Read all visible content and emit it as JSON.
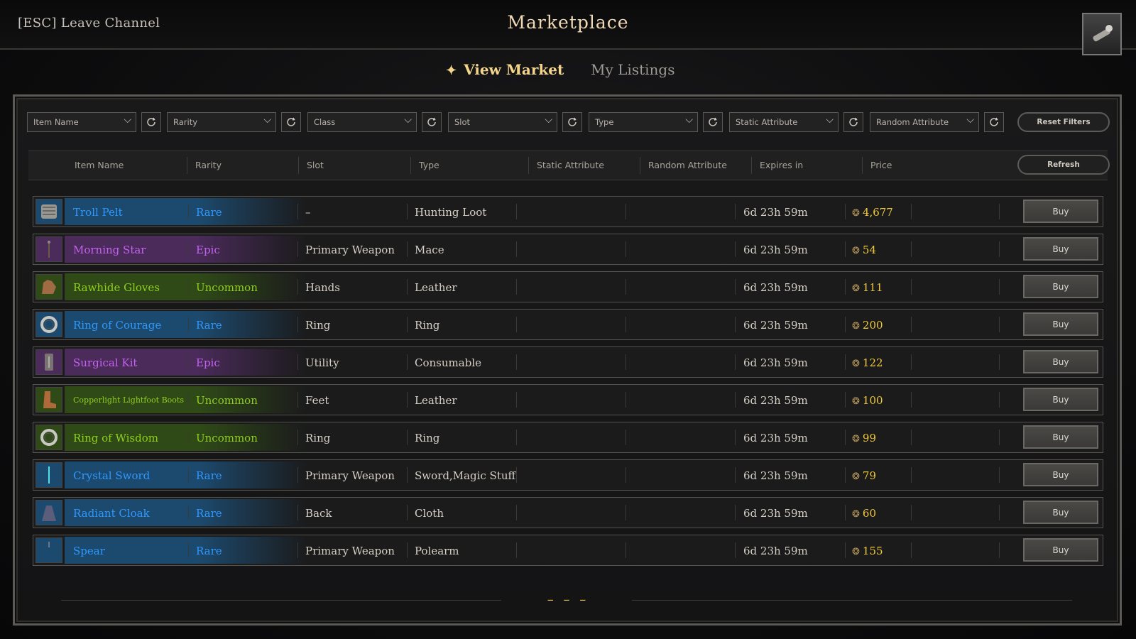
{
  "topbar": {
    "leave_label": "[ESC] Leave Channel",
    "title": "Marketplace"
  },
  "tabs": [
    {
      "label": "View Market",
      "active": true
    },
    {
      "label": "My Listings",
      "active": false
    }
  ],
  "filters": {
    "dropdowns": [
      "Item Name",
      "Rarity",
      "Class",
      "Slot",
      "Type",
      "Static Attribute",
      "Random Attribute"
    ],
    "reset_label": "Reset Filters"
  },
  "columns": [
    "Item Name",
    "Rarity",
    "Slot",
    "Type",
    "Static Attribute",
    "Random Attribute",
    "Expires in",
    "Price"
  ],
  "refresh_label": "Refresh",
  "buy_label": "Buy",
  "rarity_colors": {
    "Rare": "#2f98ff",
    "Epic": "#c463f0",
    "Uncommon": "#8fcf1e"
  },
  "items": [
    {
      "name": "Troll Pelt",
      "rarity": "Rare",
      "slot": "–",
      "type": "Hunting Loot",
      "expires": "6d 23h 59m",
      "price": "4,677",
      "icon": "pelt-icon"
    },
    {
      "name": "Morning Star",
      "rarity": "Epic",
      "slot": "Primary Weapon",
      "type": "Mace",
      "expires": "6d 23h 59m",
      "price": "54",
      "icon": "mace-icon"
    },
    {
      "name": "Rawhide Gloves",
      "rarity": "Uncommon",
      "slot": "Hands",
      "type": "Leather",
      "expires": "6d 23h 59m",
      "price": "111",
      "icon": "gloves-icon"
    },
    {
      "name": "Ring of Courage",
      "rarity": "Rare",
      "slot": "Ring",
      "type": "Ring",
      "expires": "6d 23h 59m",
      "price": "200",
      "icon": "ring-icon"
    },
    {
      "name": "Surgical Kit",
      "rarity": "Epic",
      "slot": "Utility",
      "type": "Consumable",
      "expires": "6d 23h 59m",
      "price": "122",
      "icon": "kit-icon"
    },
    {
      "name": "Copperlight Lightfoot Boots",
      "rarity": "Uncommon",
      "slot": "Feet",
      "type": "Leather",
      "expires": "6d 23h 59m",
      "price": "100",
      "icon": "boots-icon"
    },
    {
      "name": "Ring of Wisdom",
      "rarity": "Uncommon",
      "slot": "Ring",
      "type": "Ring",
      "expires": "6d 23h 59m",
      "price": "99",
      "icon": "ring-icon"
    },
    {
      "name": "Crystal Sword",
      "rarity": "Rare",
      "slot": "Primary Weapon",
      "type": "Sword,Magic Stuff",
      "expires": "6d 23h 59m",
      "price": "79",
      "icon": "sword-icon"
    },
    {
      "name": "Radiant Cloak",
      "rarity": "Rare",
      "slot": "Back",
      "type": "Cloth",
      "expires": "6d 23h 59m",
      "price": "60",
      "icon": "cloak-icon"
    },
    {
      "name": "Spear",
      "rarity": "Rare",
      "slot": "Primary Weapon",
      "type": "Polearm",
      "expires": "6d 23h 59m",
      "price": "155",
      "icon": "spear-icon"
    }
  ],
  "pagination_label": "– – –"
}
